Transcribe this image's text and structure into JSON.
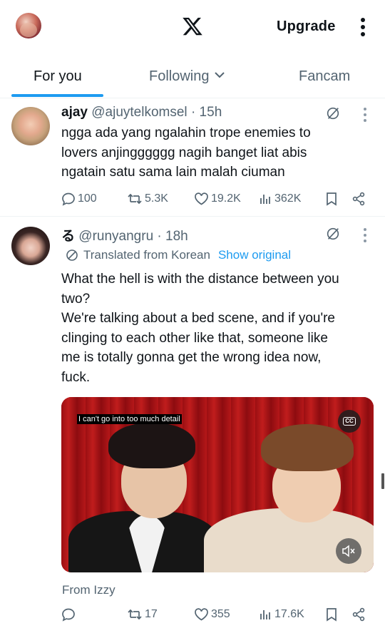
{
  "header": {
    "upgrade_label": "Upgrade",
    "logo": "x-logo-icon"
  },
  "tabs": [
    {
      "label": "For you",
      "active": true
    },
    {
      "label": "Following",
      "active": false
    },
    {
      "label": "Fancam",
      "active": false
    }
  ],
  "tweets": [
    {
      "name": "ajay",
      "handle": "@ajuytelkomsel",
      "time": "· 15h",
      "lines": [
        "ngga ada yang ngalahin trope enemies to",
        "lovers anjingggggg nagih banget liat abis",
        "ngatain satu sama lain malah ciuman"
      ],
      "actions": {
        "replies": "100",
        "reposts": "5.3K",
        "likes": "19.2K",
        "views": "362K"
      }
    },
    {
      "name": "る",
      "handle": "@runyangru",
      "time": "· 18h",
      "translated_label": "Translated from Korean",
      "show_original_label": "Show original",
      "lines": [
        "What the hell is with the distance between you",
        "two?",
        "We're talking about a bed scene, and if you're",
        "clinging to each other like that, someone like",
        "me is totally gonna get the wrong idea now,",
        "fuck."
      ],
      "media": {
        "caption": "I can't go into too much detail",
        "cc_label": "CC"
      },
      "from_label": "From Izzy",
      "actions": {
        "replies": "",
        "reposts": "17",
        "likes": "355",
        "views": "17.6K"
      }
    }
  ],
  "colors": {
    "accent": "#1d9bf0",
    "text": "#0f1419",
    "muted": "#536471"
  }
}
